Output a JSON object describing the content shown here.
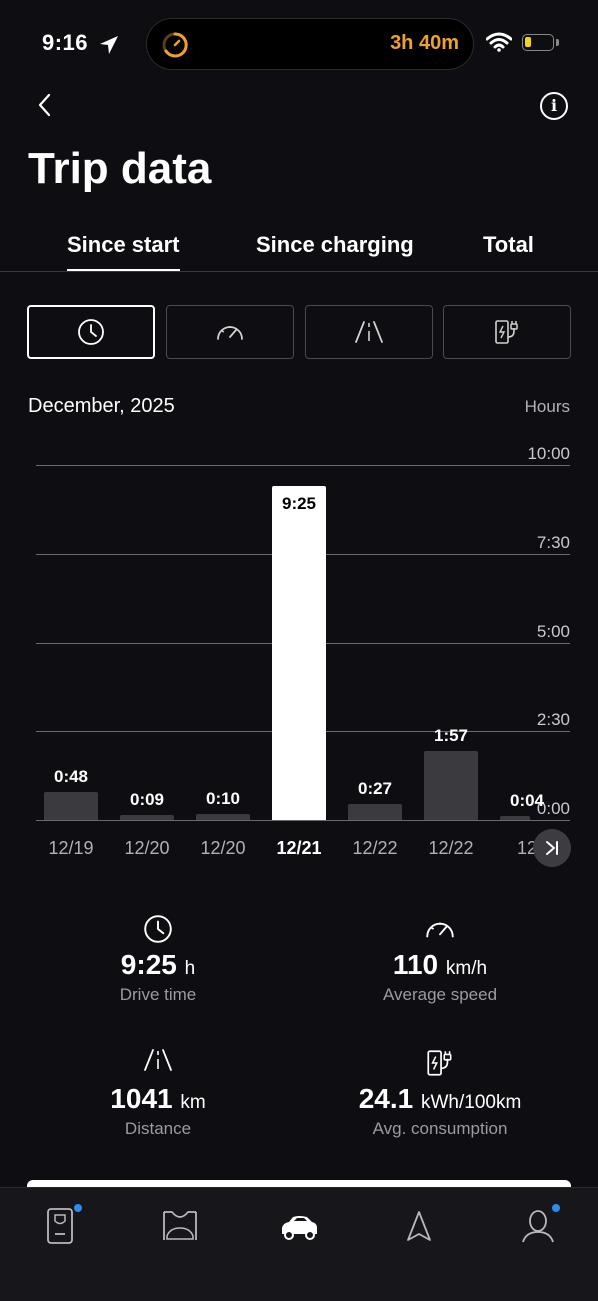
{
  "status_bar": {
    "time": "9:16",
    "activity_timer": "3h 40m"
  },
  "page": {
    "title": "Trip data"
  },
  "tabs": [
    {
      "label": "Since start",
      "active": true
    },
    {
      "label": "Since charging",
      "active": false
    },
    {
      "label": "Total",
      "active": false
    }
  ],
  "metric_buttons": [
    {
      "icon": "clock-icon",
      "active": true
    },
    {
      "icon": "speedometer-icon",
      "active": false
    },
    {
      "icon": "road-icon",
      "active": false
    },
    {
      "icon": "charging-icon",
      "active": false
    }
  ],
  "chart_header": {
    "month": "December, 2025",
    "units": "Hours"
  },
  "chart_data": {
    "type": "bar",
    "categories": [
      "12/19",
      "12/20",
      "12/20",
      "12/21",
      "12/22",
      "12/22",
      "12"
    ],
    "values": [
      0.8,
      0.15,
      0.167,
      9.417,
      0.45,
      1.95,
      0.067
    ],
    "value_labels": [
      "0:48",
      "0:09",
      "0:10",
      "9:25",
      "0:27",
      "1:57",
      "0:04"
    ],
    "selected_index": 3,
    "ylabel": "Hours",
    "yticks": [
      "10:00",
      "7:30",
      "5:00",
      "2:30",
      "0:00"
    ],
    "ylim": [
      0,
      10
    ],
    "grid": true
  },
  "stats": {
    "drive_time": {
      "value": "9:25",
      "unit": "h",
      "label": "Drive time"
    },
    "average_speed": {
      "value": "110",
      "unit": "km/h",
      "label": "Average speed"
    },
    "distance": {
      "value": "1041",
      "unit": "km",
      "label": "Distance"
    },
    "consumption": {
      "value": "24.1",
      "unit": "kWh/100km",
      "label": "Avg. consumption"
    }
  },
  "tab_bar": [
    {
      "name": "vehicle-key",
      "badge": true
    },
    {
      "name": "garage",
      "badge": false
    },
    {
      "name": "car",
      "badge": false,
      "active": true
    },
    {
      "name": "navigation",
      "badge": false
    },
    {
      "name": "profile",
      "badge": true
    }
  ],
  "colors": {
    "background": "#0e0e12",
    "accent_timer": "#f0a030",
    "badge": "#2d8cf0",
    "bar": "#3a3a3f",
    "bar_selected": "#ffffff"
  }
}
